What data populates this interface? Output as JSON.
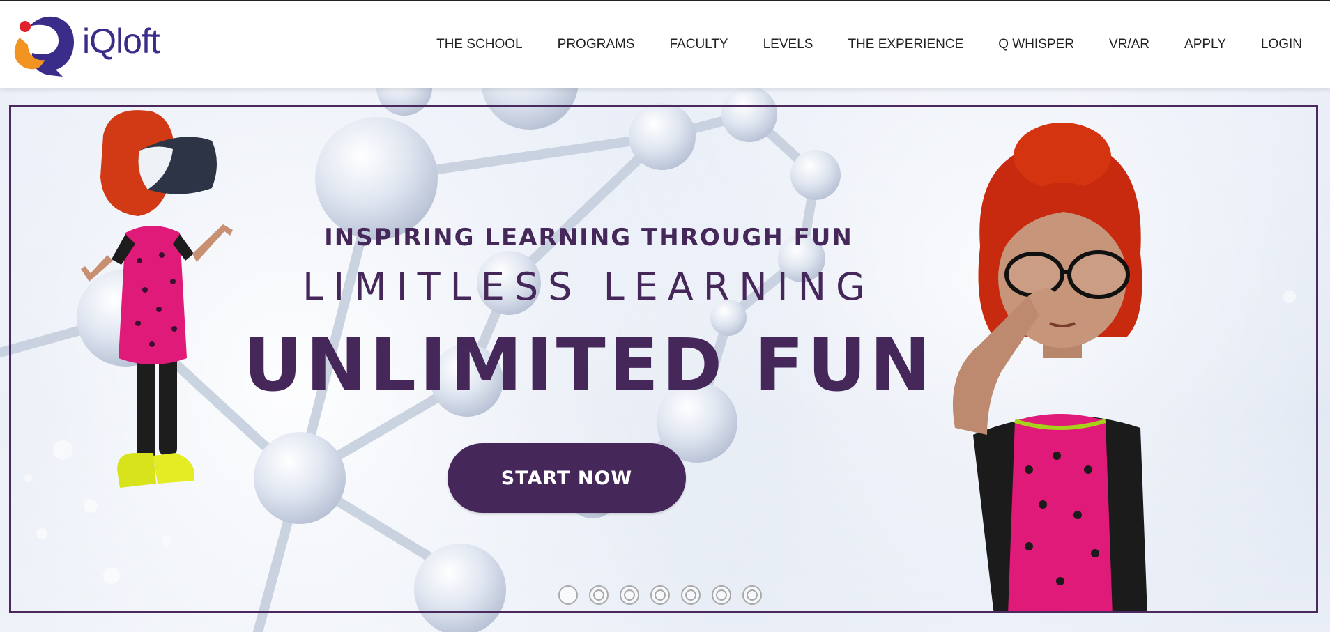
{
  "brand": {
    "name": "iQloft",
    "colors": {
      "blue": "#3a2d8a",
      "orange": "#f39321",
      "red": "#e0212c",
      "purple": "#45275a"
    }
  },
  "nav": {
    "items": [
      {
        "label": "THE SCHOOL"
      },
      {
        "label": "PROGRAMS"
      },
      {
        "label": "FACULTY"
      },
      {
        "label": "LEVELS"
      },
      {
        "label": "THE EXPERIENCE"
      },
      {
        "label": "Q WHISPER"
      },
      {
        "label": "VR/AR"
      },
      {
        "label": "APPLY"
      },
      {
        "label": "LOGIN"
      }
    ]
  },
  "hero": {
    "tagline": "INSPIRING LEARNING THROUGH FUN",
    "subline": "LIMITLESS LEARNING",
    "headline": "UNLIMITED FUN",
    "cta_label": "START NOW",
    "slide_count": 7,
    "active_slide": 1,
    "characters": [
      "girl-with-vr-headset",
      "girl-with-glasses"
    ]
  }
}
